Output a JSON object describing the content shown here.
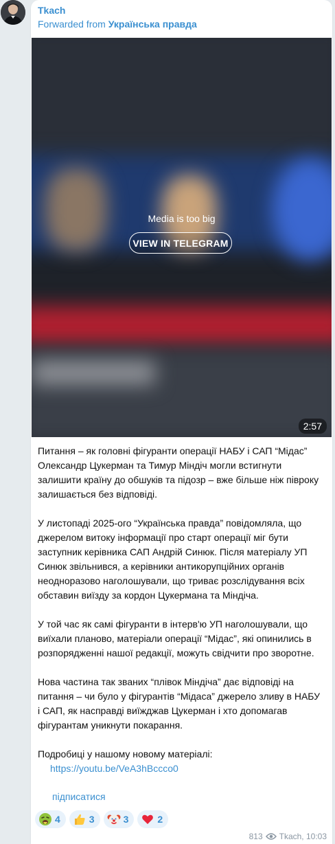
{
  "post": {
    "sender": "Tkach",
    "forwarded_prefix": "Forwarded from",
    "forwarded_source": "Українська правда"
  },
  "media": {
    "message": "Media is too big",
    "button_label": "VIEW IN TELEGRAM",
    "duration": "2:57"
  },
  "text": {
    "p1": "Питання – як головні фігуранти операції НАБУ і САП “Мідас” Олександр Цукерман та Тимур Міндіч могли встигнути залишити країну до обшуків та підозр – вже більше ніж півроку залишається без відповіді.",
    "p2": "У листопаді 2025-ого “Українська правда” повідомляла, що джерелом витоку інформації про старт операції міг бути заступник керівника САП Андрій Синюк. Після матеріалу УП Синюк звільнився, а керівники антикорупційних органів неодноразово наголошували, що триває розслідування всіх обставин виїзду за кордон Цукермана та Міндіча.",
    "p3": "У той час як самі фігуранти в інтерв'ю УП наголошували, що виїхали планово, матеріали операції “Мідас”, які опинились в розпорядженні нашої редакції, можуть свідчити про зворотне.",
    "p4": "Нова частина так званих “плівок Міндіча” дає відповіді на питання – чи було у фігурантів “Мідаса” джерело зливу в НАБУ і САП, як насправді виїжджав Цукерман і хто допомагав фігурантам уникнути покарання.",
    "p5": "Подробиці у нашому новому матеріалі:",
    "link": "https://youtu.be/VeA3hBccco0"
  },
  "subscribe_label": "підписатися",
  "reactions": [
    {
      "icon": "vomiting-face-icon",
      "count": "4"
    },
    {
      "icon": "thumbs-up-icon",
      "count": "3"
    },
    {
      "icon": "clown-face-icon",
      "count": "3"
    },
    {
      "icon": "red-heart-icon",
      "count": "2"
    }
  ],
  "meta": {
    "views": "813",
    "author_time": "Tkach, 10:03"
  },
  "colors": {
    "accent": "#3a8fd0",
    "background": "#e6ebee",
    "bubble": "#ffffff"
  }
}
